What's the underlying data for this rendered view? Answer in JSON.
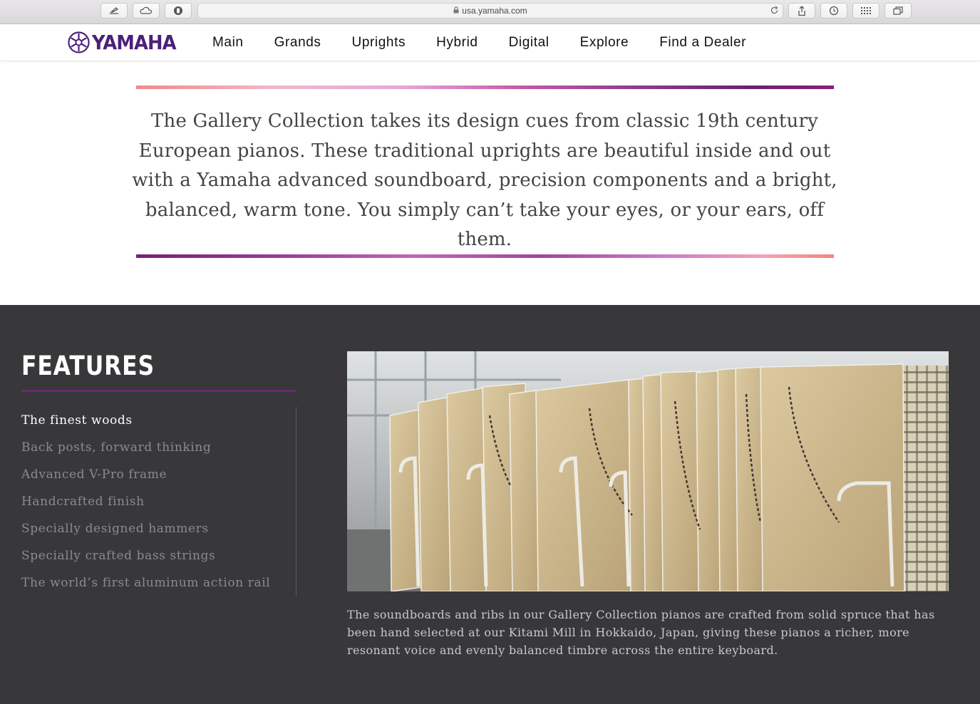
{
  "browser": {
    "url": "usa.yamaha.com"
  },
  "header": {
    "logo_text": "YAMAHA",
    "nav": [
      "Main",
      "Grands",
      "Uprights",
      "Hybrid",
      "Digital",
      "Explore",
      "Find a Dealer"
    ]
  },
  "intro": {
    "text": "The Gallery Collection takes its design cues from classic 19th century European pianos. These traditional uprights are beautiful inside and out with a Yamaha advanced soundboard, precision components and a bright, balanced, warm tone. You simply can’t take your eyes, or your ears, off them."
  },
  "features": {
    "title": "FEATURES",
    "items": [
      "The finest woods",
      "Back posts, forward thinking",
      "Advanced V-Pro frame",
      "Handcrafted finish",
      "Specially designed hammers",
      "Specially crafted bass strings",
      "The world’s first aluminum action rail"
    ],
    "active_index": 0,
    "caption": "The soundboards and ribs in our Gallery Collection pianos are crafted from solid spruce that has been hand selected at our Kitami Mill in Hokkaido, Japan, giving these pianos a richer, more resonant voice and evenly balanced timbre across the entire keyboard."
  },
  "colors": {
    "brand": "#4b1f7a",
    "features_bg": "#38383b",
    "accent": "#6d2a6d"
  }
}
